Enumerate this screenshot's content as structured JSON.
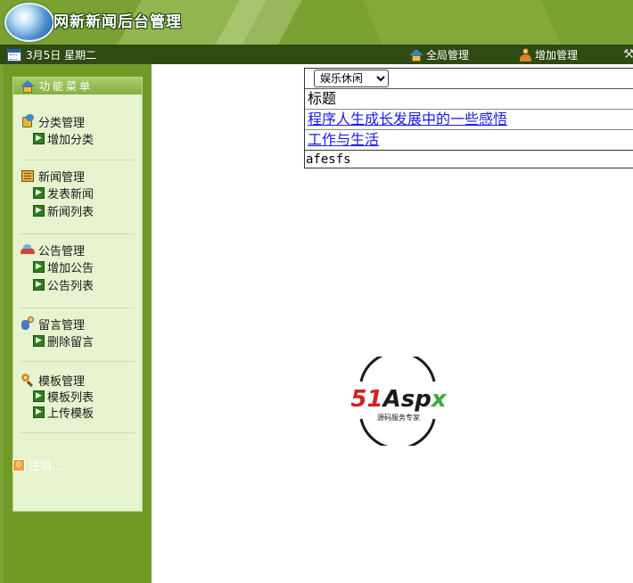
{
  "header": {
    "title": "网新新闻后台管理"
  },
  "topbar": {
    "date": "3月5日 星期二",
    "links": [
      {
        "label": "全局管理",
        "icon": "home-icon"
      },
      {
        "label": "增加管理",
        "icon": "user-icon"
      }
    ]
  },
  "sidebar": {
    "menu_title": "功能菜单",
    "groups": [
      {
        "label": "分类管理",
        "icon": "coins-icon",
        "items": [
          "增加分类"
        ]
      },
      {
        "label": "新闻管理",
        "icon": "news-icon",
        "items": [
          "发表新闻",
          "新闻列表"
        ]
      },
      {
        "label": "公告管理",
        "icon": "car-icon",
        "items": [
          "增加公告",
          "公告列表"
        ]
      },
      {
        "label": "留言管理",
        "icon": "message-icon",
        "items": [
          "删除留言"
        ]
      },
      {
        "label": "模板管理",
        "icon": "template-icon",
        "items": [
          "模板列表",
          "上传模板"
        ]
      }
    ],
    "logout": "注销..."
  },
  "main": {
    "category_select": {
      "selected": "娱乐休闲",
      "options": [
        "娱乐休闲"
      ]
    },
    "table_header": "标题",
    "rows": [
      "程序人生成长发展中的一些感悟",
      "工作与生活"
    ],
    "footer_text": "afesfs"
  },
  "brand": {
    "name": "51Aspx",
    "tagline": "源码服务专家"
  },
  "colors": {
    "accent": "#7aa232",
    "dark_bar": "#2f4a12",
    "panel": "#e7f3cf",
    "link": "#1a1aee",
    "brand_red": "#d42020",
    "brand_green": "#3caa3c"
  }
}
